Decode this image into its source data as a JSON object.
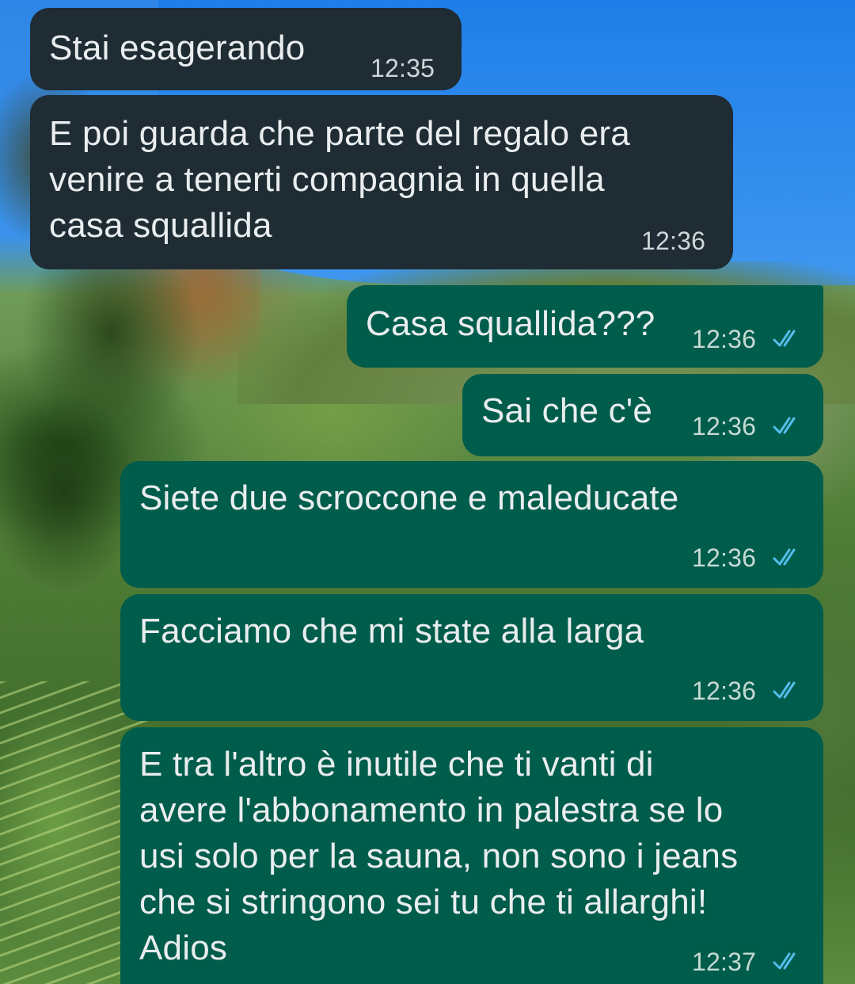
{
  "messages": [
    {
      "direction": "in",
      "text": "Stai esagerando",
      "time": "12:35"
    },
    {
      "direction": "in",
      "text": "E poi guarda che parte del regalo era\nvenire a tenerti compagnia in quella\ncasa squallida",
      "time": "12:36"
    },
    {
      "direction": "out",
      "text": "Casa squallida???",
      "time": "12:36",
      "status_icon": "double-check-icon"
    },
    {
      "direction": "out",
      "text": "Sai che c'è",
      "time": "12:36",
      "status_icon": "double-check-icon"
    },
    {
      "direction": "out",
      "text": "Siete due scroccone e maleducate",
      "time": "12:36",
      "status_icon": "double-check-icon"
    },
    {
      "direction": "out",
      "text": "Facciamo che mi state alla larga",
      "time": "12:36",
      "status_icon": "double-check-icon"
    },
    {
      "direction": "out",
      "text": "E tra l'altro è inutile che ti vanti di\navere l'abbonamento in palestra se lo\nusi solo per la sauna, non sono i jeans\nche si stringono sei tu che ti allarghi!\nAdios",
      "time": "12:37",
      "status_icon": "double-check-icon"
    }
  ],
  "colors": {
    "incoming_bubble": "#1f2c34",
    "outgoing_bubble": "#005c4b",
    "read_ticks": "#53bdeb",
    "message_text": "#e9edef"
  }
}
